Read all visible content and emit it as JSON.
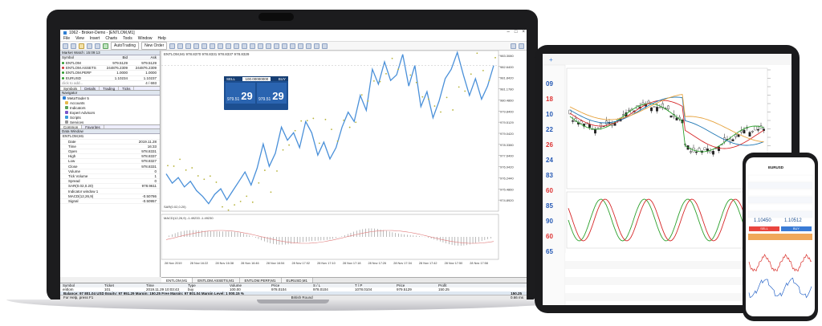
{
  "terminal": {
    "title": "1062 - Broker-Demo - [ENTLOM,M1]",
    "menu": [
      "File",
      "View",
      "Insert",
      "Charts",
      "Tools",
      "Window",
      "Help"
    ],
    "toolbar": {
      "autotrading": "AutoTrading",
      "new_order": "New Order"
    },
    "market_watch": {
      "header": "Market Watch: 15:09:13",
      "columns": [
        "Symbol",
        "Bid",
        "Ask"
      ],
      "rows": [
        {
          "symbol": "ENTLOM",
          "bid": "979.5129",
          "ask": "979.5129"
        },
        {
          "symbol": "ENTLOM.ASSETS",
          "bid": "244876.2309",
          "ask": "244876.2309"
        },
        {
          "symbol": "ENTLOM.PERF",
          "bid": "1.0000",
          "ask": "1.0000"
        },
        {
          "symbol": "EURUSD",
          "bid": "1.10234",
          "ask": "1.10237"
        }
      ],
      "add_row": "click to add...",
      "count": "4 / 693",
      "tabs": [
        "Symbols",
        "Details",
        "Trading",
        "Ticks"
      ]
    },
    "navigator": {
      "header": "Navigator",
      "items": [
        "MetaTrader 5",
        "Accounts",
        "Indicators",
        "Expert Advisors",
        "Scripts",
        "Services"
      ],
      "tabs": [
        "Common",
        "Favorites"
      ]
    },
    "data_window": {
      "header": "Data Window",
      "symbol": "ENTLOM,M1",
      "rows": [
        {
          "k": "Date",
          "v": "2019.11.28"
        },
        {
          "k": "Time",
          "v": "16:33"
        },
        {
          "k": "Open",
          "v": "978.8331"
        },
        {
          "k": "High",
          "v": "978.8337"
        },
        {
          "k": "Low",
          "v": "978.8327"
        },
        {
          "k": "Close",
          "v": "978.8331"
        },
        {
          "k": "Volume",
          "v": "0"
        },
        {
          "k": "Tick Volume",
          "v": "1"
        },
        {
          "k": "Spread",
          "v": "0"
        },
        {
          "k": "SAR(0.02,0.20)",
          "v": "978.9611"
        },
        {
          "k": "Indicator window 1",
          "v": ""
        },
        {
          "k": "MACD(12,26,9)",
          "v": "-0.50786"
        },
        {
          "k": "Signal",
          "v": "-0.50957"
        }
      ]
    },
    "chart": {
      "header": "ENTLOM,M1 978.8370 978.8331 978.8337 978.8329",
      "indicator_label": "MACD(12,26,9) -1.49233 -1.49230",
      "sar_label": "SAR(0.02,0.20)",
      "price_ticks": [
        "983.3080",
        "982.6400",
        "981.8420",
        "981.1780",
        "980.4860",
        "979.8400",
        "979.5129",
        "979.0420",
        "978.3380",
        "977.6400",
        "976.9420",
        "976.2440",
        "975.4860",
        "974.8920"
      ],
      "time_ticks": [
        "28 Nov 2019",
        "28 Nov 16:22",
        "28 Nov 16:38",
        "28 Nov 16:46",
        "28 Nov 16:54",
        "28 Nov 17:02",
        "28 Nov 17:10",
        "28 Nov 17:18",
        "28 Nov 17:26",
        "28 Nov 17:34",
        "28 Nov 17:42",
        "28 Nov 17:50",
        "28 Nov 17:58"
      ],
      "tabs": [
        "ENTLOM,M1",
        "ENTLOM.ASSETS,M1",
        "ENTLOM.PERF,M1",
        "EURUSD,M1"
      ]
    },
    "trade_panel": {
      "sell_label": "SELL",
      "buy_label": "BUY",
      "volume": "100.00000000",
      "sell_price_small": "979.51",
      "sell_price_big": "29",
      "buy_price_small": "979.51",
      "buy_price_big": "29"
    },
    "trade_table": {
      "columns": [
        "Symbol",
        "Ticket",
        "Time",
        "Type",
        "Volume",
        "Price",
        "S / L",
        "T / P",
        "Price",
        "Profit"
      ],
      "row": [
        "entlom",
        "101",
        "2019.11.29 10:03:43",
        "buy",
        "100.00",
        "978.0104",
        "978.0104",
        "1078.0104",
        "979.5129",
        "150.25"
      ],
      "balance": "Balance: 97 801.04 USD  Equity: 97 951.29  Margin: 150.25  Free Margin: 97 801.04  Margin Level: 1 000.15 %",
      "balance_profit": "150.25",
      "tabs": [
        "Trade",
        "Exposure",
        "History",
        "News",
        "Mailbox",
        "Calendar",
        "Company",
        "Market",
        "Alerts",
        "Signals",
        "Articles",
        "Code Base",
        "Experts",
        "Journal"
      ],
      "tester": "Strategy Tester"
    },
    "status": {
      "help": "For Help, press F1",
      "profile": "British Round",
      "ping": "0.66 ms"
    }
  },
  "tablet": {
    "symbol_prices": [
      "09",
      "18",
      "10",
      "22",
      "26",
      "24",
      "83",
      "60",
      "85",
      "90",
      "60",
      "65"
    ]
  },
  "phone": {
    "title": "EURUSD",
    "prices": [
      "1.10450",
      "1.10512"
    ],
    "sell_label": "SELL",
    "buy_label": "BUY"
  },
  "colors": {
    "accent": "#1d4f91",
    "line": "#4a90d9",
    "sar": "#b7b33a",
    "device": "#1b1b1d"
  },
  "chart_data": {
    "type": "line",
    "price_series": [
      976.8,
      976.3,
      976.6,
      976.1,
      976.4,
      975.9,
      975.6,
      975.2,
      975.7,
      976.0,
      975.4,
      975.9,
      976.4,
      976.9,
      976.2,
      977.1,
      978.4,
      977.2,
      977.9,
      979.3,
      978.6,
      979.0,
      978.2,
      979.6,
      979.0,
      977.8,
      978.5,
      977.6,
      978.2,
      979.3,
      980.1,
      979.6,
      981.0,
      980.2,
      982.4,
      981.6,
      982.8,
      981.8,
      982.1,
      983.2,
      981.5,
      982.6,
      980.4,
      981.2,
      979.8,
      980.7,
      981.9,
      982.4,
      983.3,
      982.1,
      981.0,
      981.9,
      980.8,
      981.5,
      982.6
    ],
    "ylim": [
      974.8,
      983.4
    ]
  }
}
